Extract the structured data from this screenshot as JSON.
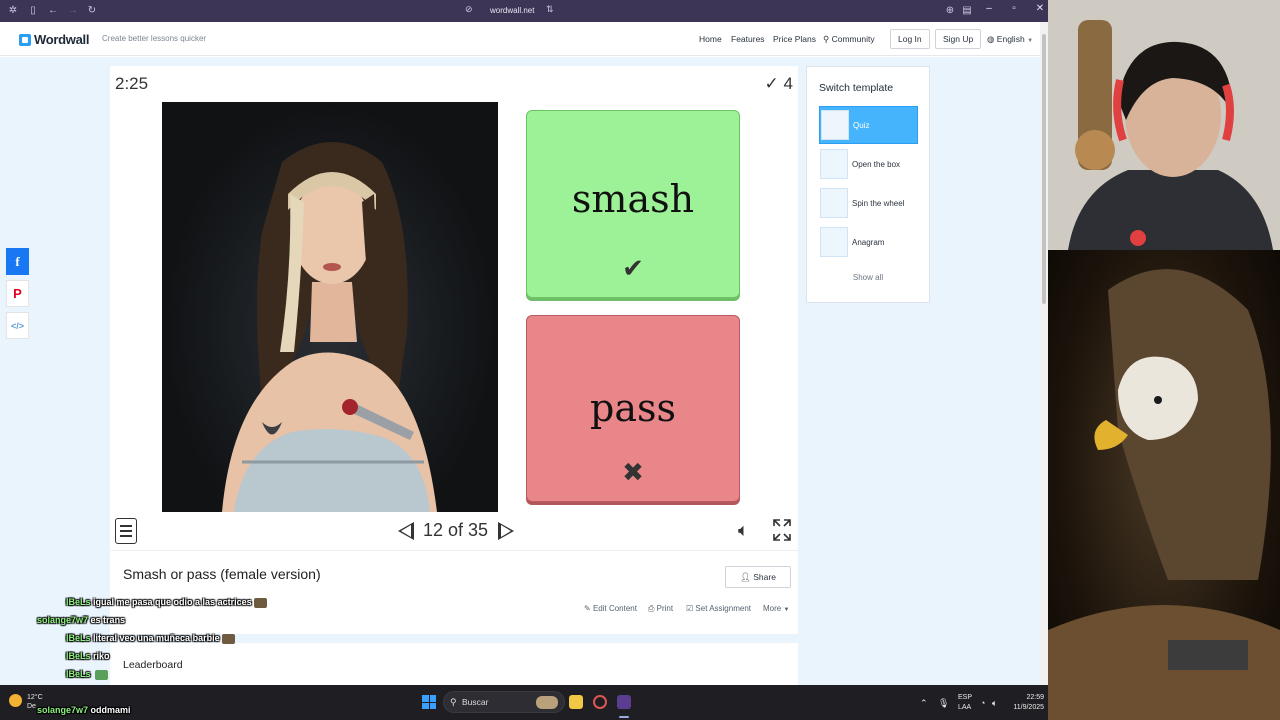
{
  "browser": {
    "url": "wordwall.net",
    "window_controls": [
      "minimize-icon",
      "maximize-icon",
      "close-icon"
    ]
  },
  "site": {
    "logo": "Wordwall",
    "tagline": "Create better lessons quicker",
    "nav": {
      "home": "Home",
      "features": "Features",
      "price_plans": "Price Plans",
      "community": "Community",
      "login": "Log In",
      "signup": "Sign Up",
      "language": "English"
    }
  },
  "game": {
    "timer": "2:25",
    "score": "4",
    "answers": [
      {
        "label": "smash",
        "result": "correct",
        "color": "#9df297"
      },
      {
        "label": "pass",
        "result": "incorrect",
        "color": "#e8868a"
      }
    ],
    "pager": "12 of 35"
  },
  "activity": {
    "title": "Smash or pass (female version)",
    "share": "Share",
    "actions": {
      "edit": "Edit Content",
      "print": "Print",
      "assign": "Set Assignment",
      "more": "More"
    },
    "leaderboard": "Leaderboard"
  },
  "templates": {
    "title": "Switch template",
    "items": [
      "Quiz",
      "Open the box",
      "Spin the wheel",
      "Anagram"
    ],
    "show_all": "Show all"
  },
  "chat": [
    {
      "user": "lBeLs",
      "text": "igual me pasa que odio a las actrices"
    },
    {
      "user": "solange7w7",
      "text": "es trans"
    },
    {
      "user": "lBeLs",
      "text": "literal veo una muñeca barbie"
    },
    {
      "user": "lBeLs",
      "text": "riko"
    },
    {
      "user": "lBeLs",
      "text": ""
    },
    {
      "user": "lBeLs",
      "text": ""
    },
    {
      "user": "solange7w7",
      "text": "oddmami"
    }
  ],
  "taskbar": {
    "temperature": "12°C",
    "weather_text": "De",
    "search": "Buscar",
    "language": "ESP",
    "language_sub": "LAA",
    "time": "22:59",
    "date": "11/9/2025"
  },
  "colors": {
    "brand": "#2a9df4",
    "correct": "#9df297",
    "incorrect": "#e8868a",
    "active_template": "#46b4fd"
  }
}
